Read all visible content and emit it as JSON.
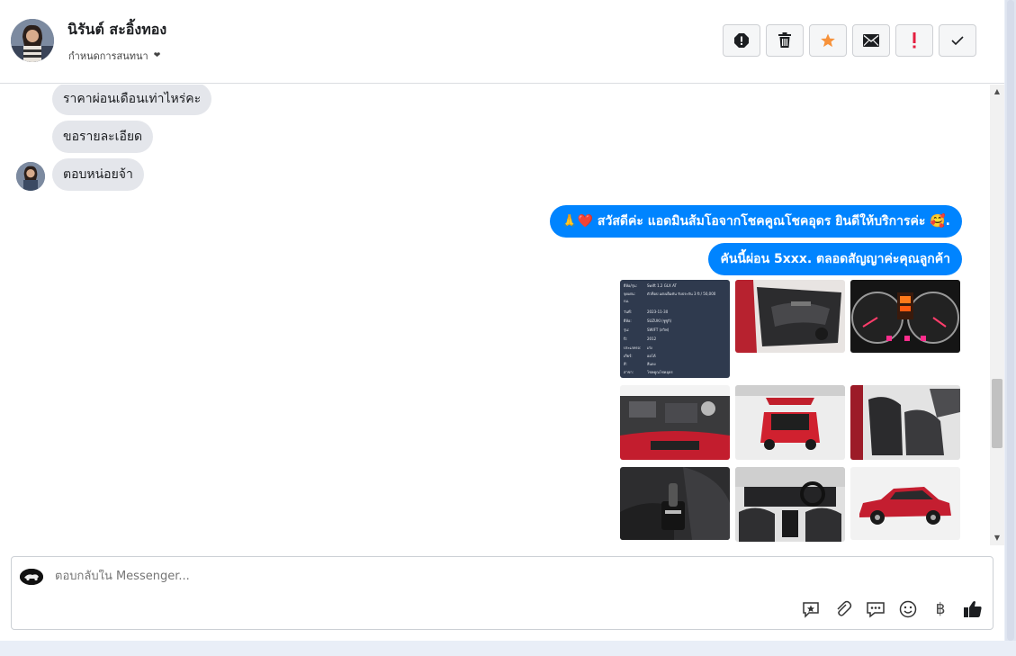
{
  "header": {
    "contact_name": "นิรันต์ สะอิ้งทอง",
    "assign_label": "กำหนดการสนทนา",
    "actions": [
      {
        "name": "spam-button",
        "icon": "alert-circle-icon"
      },
      {
        "name": "delete-button",
        "icon": "trash-icon"
      },
      {
        "name": "star-button",
        "icon": "star-icon"
      },
      {
        "name": "mark-unread-button",
        "icon": "envelope-icon"
      },
      {
        "name": "priority-button",
        "icon": "exclamation-icon"
      },
      {
        "name": "done-button",
        "icon": "check-icon"
      }
    ]
  },
  "messages": {
    "incoming": [
      "ราคาผ่อนเดือนเท่าไหร่คะ",
      "ขอรายละเอียด",
      "ตอบหน่อยจ้า"
    ],
    "outgoing": [
      "🙏❤️ สวัสดีค่ะ แอดมินส้มโอจากโชคคูณโชคอุดร ยินดีให้บริการค่ะ 🥰.",
      "คันนี้ผ่อน 5xxx. ตลอดสัญญาค่ะคุณลูกค้า"
    ]
  },
  "spec_sheet": {
    "rows": [
      [
        "ยี่ห้อ/รุ่น:",
        "Swift 1.2 GLX AT"
      ],
      [
        "จุดเด่น:",
        "ตัวท็อป แต่งเต็มคัน รับประกัน 3 ปี / 50,000"
      ],
      [
        "",
        "กม."
      ],
      [
        "วันที่:",
        "2023-11-30"
      ],
      [
        "ยี่ห้อ:",
        "SUZUKI (ซูซูกิ)"
      ],
      [
        "รุ่น:",
        "SWIFT (สวิฟ)"
      ],
      [
        "ปี:",
        "2012"
      ],
      [
        "ประเภทรถ:",
        "เก๋ง"
      ],
      [
        "เกียร์:",
        "ออโต้"
      ],
      [
        "สี:",
        "สีแดง"
      ],
      [
        "สาขา:",
        "โชคคูณโชคอุดร"
      ]
    ]
  },
  "photos": [
    {
      "name": "spec-sheet-photo"
    },
    {
      "name": "door-panel-photo"
    },
    {
      "name": "dashboard-gauge-photo"
    },
    {
      "name": "engine-bay-photo"
    },
    {
      "name": "rear-hatch-photo"
    },
    {
      "name": "front-seats-photo"
    },
    {
      "name": "gear-shifter-photo"
    },
    {
      "name": "interior-cabin-photo"
    },
    {
      "name": "side-view-photo"
    }
  ],
  "composer": {
    "placeholder": "ตอบกลับใน Messenger...",
    "tools": [
      {
        "name": "saved-reply-icon",
        "glyph": "☆"
      },
      {
        "name": "attach-icon",
        "glyph": "📎"
      },
      {
        "name": "chat-bubble-icon",
        "glyph": "💬"
      },
      {
        "name": "emoji-icon",
        "glyph": "☺"
      },
      {
        "name": "baht-icon",
        "glyph": "฿"
      },
      {
        "name": "thumbs-up-icon",
        "glyph": "👍"
      }
    ]
  }
}
